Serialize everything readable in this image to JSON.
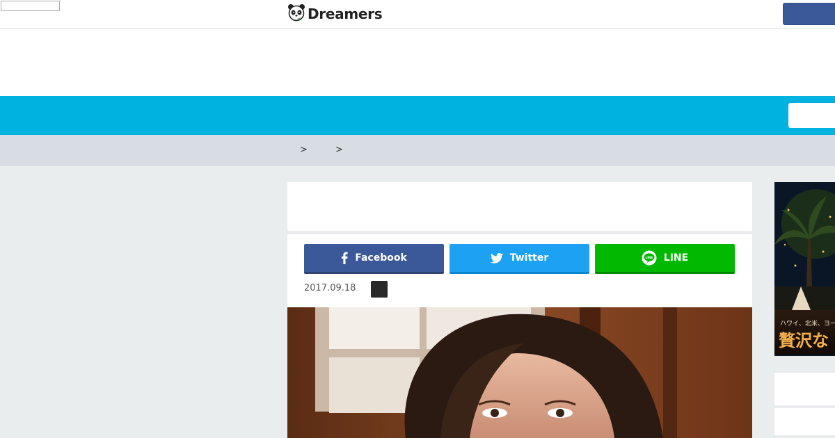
{
  "header": {
    "logo_text": "Dreamers",
    "search_placeholder": ""
  },
  "breadcrumb": {
    "separators": [
      ">",
      ">"
    ]
  },
  "share": {
    "facebook_label": "Facebook",
    "twitter_label": "Twitter",
    "line_label": "LINE"
  },
  "article": {
    "date": "2017.09.18"
  },
  "side_banner": {
    "subtitle": "ハワイ、北米、ヨー",
    "headline": "贅沢な"
  },
  "colors": {
    "cyan_bar": "#00b2df",
    "facebook": "#3b5998",
    "twitter": "#1da1f2",
    "line": "#00b900"
  },
  "icons": {
    "logo": "panda-icon",
    "facebook": "facebook-icon",
    "twitter": "twitter-bird-icon",
    "line": "line-chat-icon"
  }
}
